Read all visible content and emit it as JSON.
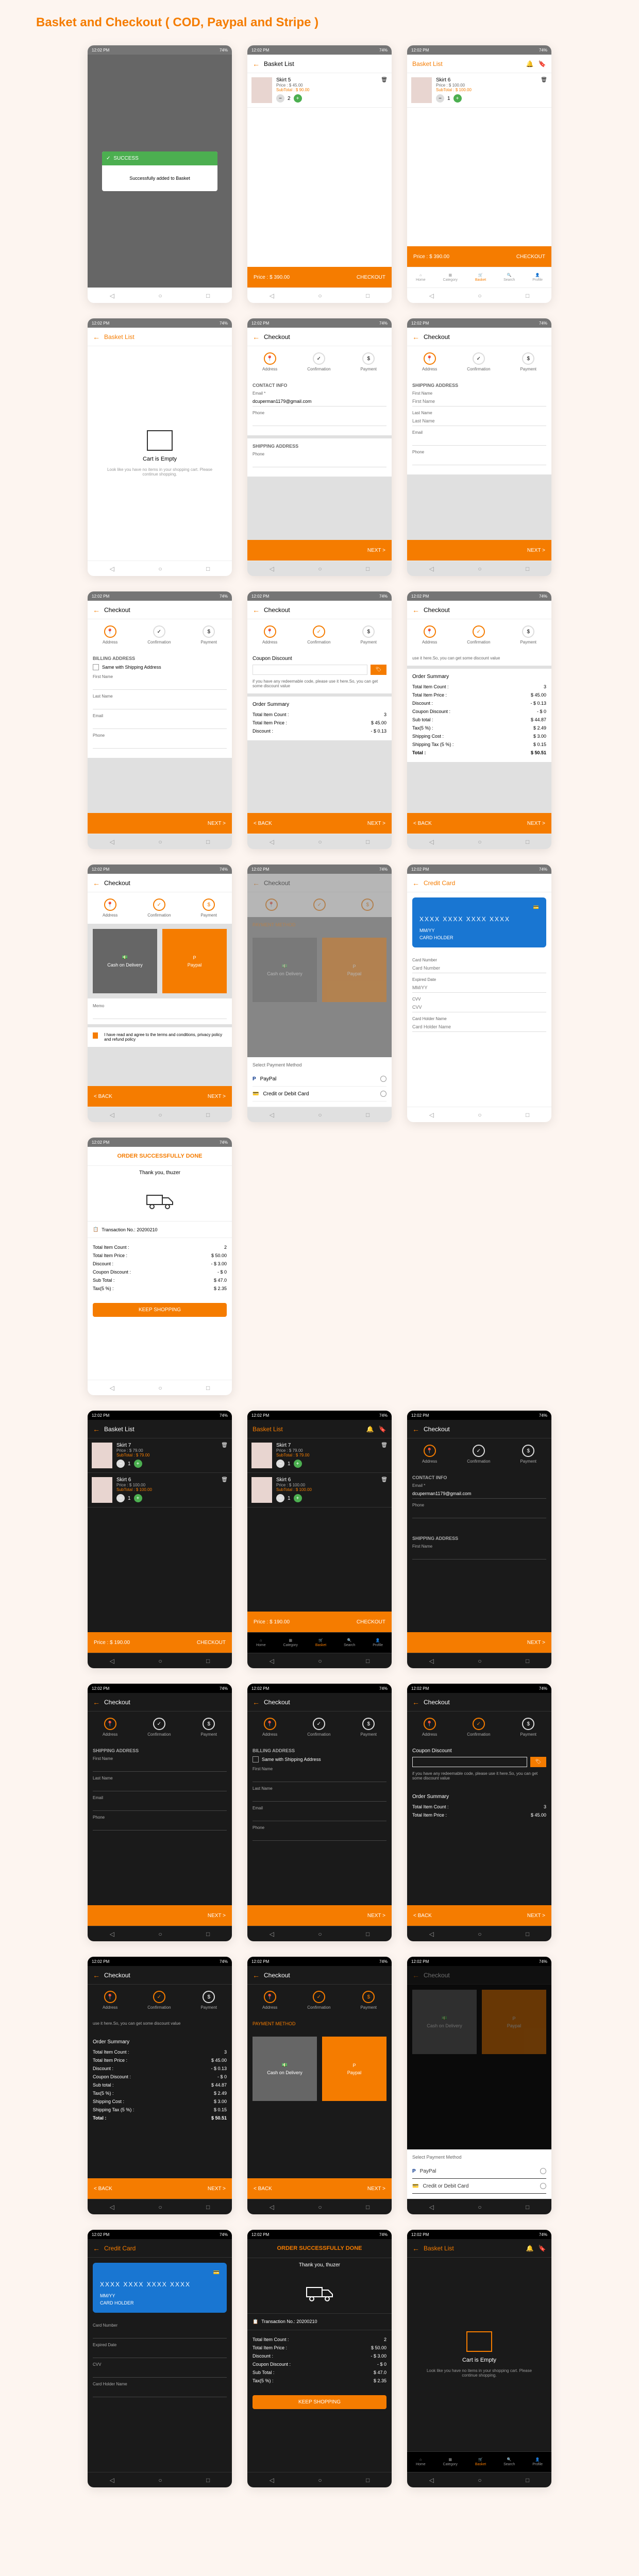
{
  "page_title": "Basket and Checkout ( COD, Paypal and Stripe )",
  "statusbar": {
    "time": "12:02 PM",
    "battery": "74%"
  },
  "basket": {
    "title": "Basket List",
    "items": [
      {
        "name": "Skirt 5",
        "price": "$ 45.00",
        "subtotal": "$ 90.00",
        "qty": "2"
      },
      {
        "name": "Skirt 6",
        "price": "$ 100.00",
        "subtotal": "$ 100.00",
        "qty": "1"
      },
      {
        "name": "Skirt 7",
        "price": "$ 79.00",
        "subtotal": "$ 79.00",
        "qty": "1"
      }
    ],
    "total_label": "Price :",
    "total": "$ 390.00",
    "dark_total": "$ 190.00",
    "checkout_btn": "CHECKOUT",
    "empty_title": "Cart is Empty",
    "empty_msg": "Look like you have no items in your shopping cart. Please continue shopping."
  },
  "modal": {
    "title": "SUCCESS",
    "msg": "Successfully added to Basket"
  },
  "checkout": {
    "title": "Checkout",
    "steps": [
      "Address",
      "Confirmation",
      "Payment"
    ],
    "contact_title": "CONTACT INFO",
    "shipping_title": "SHIPPING ADDRESS",
    "billing_title": "BILLING ADDRESS",
    "email_label": "Email *",
    "email_value": "dcuperman1179@gmail.com",
    "phone_label": "Phone",
    "fname_label": "First Name",
    "lname_label": "Last Name",
    "same_label": "Same with Shipping Address",
    "next_btn": "NEXT >",
    "back_btn": "< BACK"
  },
  "coupon": {
    "title": "Coupon Discount",
    "msg": "if you have any redeemable code, please use it here.So, you can get some discount value",
    "use_msg": "use it here.So, you can get some discount value"
  },
  "summary": {
    "title": "Order Summary",
    "rows": [
      {
        "label": "Total Item Count :",
        "val": "3"
      },
      {
        "label": "Total Item Price :",
        "val": "$ 45.00"
      },
      {
        "label": "Discount :",
        "val": "- $ 0.13"
      },
      {
        "label": "Coupon Discount :",
        "val": "- $ 0"
      },
      {
        "label": "Sub total :",
        "val": "$ 44.87"
      },
      {
        "label": "Tax(5 %) :",
        "val": "$ 2.49"
      },
      {
        "label": "Shipping Cost :",
        "val": "$ 3.00"
      },
      {
        "label": "Shipping Tax (5 %) :",
        "val": "$ 0.15"
      },
      {
        "label": "Total :",
        "val": "$ 50.51"
      }
    ],
    "short_rows": [
      {
        "label": "Total Item Count :",
        "val": "3"
      },
      {
        "label": "Total Item Price :",
        "val": "$ 45.00"
      },
      {
        "label": "Discount :",
        "val": "- $ 0.13"
      }
    ]
  },
  "payment": {
    "title": "PAYMENT METHOD",
    "cod": "Cash on Delivery",
    "paypal": "Paypal",
    "memo_label": "Memo",
    "terms": "I have read and agree to the terms and conditions, privacy policy and refund policy",
    "select_label": "Select Payment Method",
    "paypal_opt": "PayPal",
    "card_opt": "Credit or Debit Card"
  },
  "card": {
    "title": "Credit Card",
    "number": "XXXX XXXX XXXX XXXX",
    "expiry": "MM/YY",
    "holder": "CARD HOLDER",
    "num_label": "Card Number",
    "num_ph": "Card Number",
    "exp_label": "Expired Date",
    "exp_ph": "MM/YY",
    "cvv_label": "CVV",
    "cvv_ph": "CVV",
    "name_label": "Card Holder Name",
    "name_ph": "Card Holder Name"
  },
  "success": {
    "title": "ORDER SUCCESSFULLY DONE",
    "thanks": "Thank you, thuzer",
    "txn": "Transaction No.: 20200210",
    "rows": [
      {
        "label": "Total Item Count :",
        "val": "2"
      },
      {
        "label": "Total Item Price :",
        "val": "$ 50.00"
      },
      {
        "label": "Discount :",
        "val": "- $ 3.00"
      },
      {
        "label": "Coupon Discount :",
        "val": "- $ 0"
      },
      {
        "label": "Sub Total :",
        "val": "$ 47.0"
      },
      {
        "label": "Tax(5 %) :",
        "val": "$ 2.35"
      }
    ],
    "keep_btn": "KEEP SHOPPING"
  },
  "nav": {
    "items": [
      "Home",
      "Category",
      "Basket",
      "Search",
      "Profile"
    ]
  }
}
